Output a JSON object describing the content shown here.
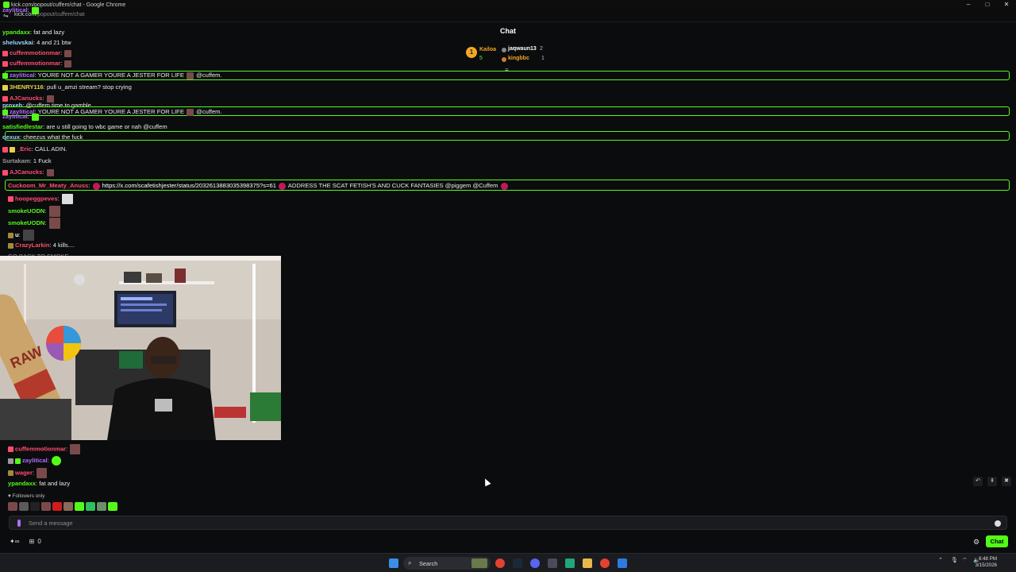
{
  "browser": {
    "window_title": "kick.com/popout/cuffem/chat - Google Chrome",
    "url_domain": "kick.com",
    "url_path": "/popout/cuffem/chat"
  },
  "chat": {
    "title": "Chat",
    "leaderboard": {
      "rank_badge": "1",
      "first": {
        "name": "Kailoa",
        "count": "5"
      },
      "second": {
        "name": "jaqwaun13",
        "count": "2"
      },
      "third": {
        "name": "kingbbc",
        "count": "1"
      }
    },
    "messages_top": [
      {
        "user": "zaylitical",
        "text": "",
        "color": "#b06cff"
      },
      {
        "user": "ypandaxx",
        "text": "fat and lazy",
        "color": "#53fc18"
      },
      {
        "user": "sheluvskai",
        "text": "4 and 21 btw",
        "color": "#9fd6ff"
      },
      {
        "user": "cuffemmotionmar",
        "text": "",
        "color": "#ff4d6d"
      },
      {
        "user": "cuffemmotionmar",
        "text": "",
        "color": "#ff4d6d"
      },
      {
        "user": "zaylitical",
        "text": "YOURE NOT A GAMER YOURE A JESTER FOR LIFE",
        "mention": "@cuffem.",
        "color": "#b06cff"
      },
      {
        "user": "3HENRY116",
        "text": "pull u_amzi stream? stop crying",
        "color": "#e8d24a"
      },
      {
        "user": "AJCanucks",
        "text": "",
        "color": "#ff4d6d"
      },
      {
        "user": "proxeh",
        "text": "@cuffem time to gamble",
        "color": "#9fd6ff"
      },
      {
        "user": "zaylitical",
        "text": "YOURE NOT A GAMER YOURE A JESTER FOR LIFE",
        "mention": "@cuffem.",
        "color": "#b06cff"
      },
      {
        "user": "zaylitical",
        "text": "",
        "color": "#b06cff"
      },
      {
        "user": "satisfiedlestar",
        "text": "are u still going to wbc game or nah @cuffem",
        "color": "#53fc18"
      },
      {
        "user": "qexux",
        "text": "cheezus what the fuck",
        "color": "#9fd6ff"
      },
      {
        "user": "_Eric",
        "text": "CALL ADIN.",
        "color": "#ff4d6d"
      },
      {
        "user": "Surtakam",
        "text": "1 Fuck",
        "color": "#9a9a9a"
      },
      {
        "user": "AJCanucks",
        "text": "",
        "color": "#ff4d6d"
      },
      {
        "user": "Cuckoom_Mr_Meaty_Anuss",
        "link": "https://x.com/scafetishjester/status/2032613883035398375?s=61",
        "text": "ADDRESS THE SCAT FETISH'S AND CUCK FANTASIES @piggem @Cuffem",
        "color": "#ff4d6d"
      },
      {
        "user": "hoopeggpeves",
        "text": "",
        "color": "#ff4d6d"
      },
      {
        "user": "smokeUODN",
        "text": "",
        "color": "#53fc18"
      },
      {
        "user": "smokeUODN",
        "text": "",
        "color": "#53fc18"
      },
      {
        "user": "u",
        "text": "",
        "color": "#ffffff"
      },
      {
        "user": "CrazyLarkin",
        "text": "4 kills....",
        "color": "#ff4d6d"
      },
      {
        "user": "",
        "text": "GO BACK TO SMOKE",
        "color": "#ff4d6d"
      }
    ],
    "messages_bottom": [
      {
        "user": "cuffemmotionmar",
        "text": "",
        "color": "#ff4d6d"
      },
      {
        "user": "zaylitical",
        "text": "",
        "color": "#b06cff"
      },
      {
        "user": "wager",
        "text": "",
        "color": "#ff4d6d"
      },
      {
        "user": "ypandaxx",
        "text": "fat and lazy",
        "color": "#53fc18"
      }
    ],
    "followers_only": "Followers only",
    "input_placeholder": "Send a message",
    "footer_count": "0",
    "send_button": "Chat"
  },
  "taskbar": {
    "search_label": "Search",
    "time": "6:48 PM",
    "date": "3/15/2026"
  },
  "colors": {
    "accent": "#53fc18",
    "background": "#0b0c0e"
  }
}
